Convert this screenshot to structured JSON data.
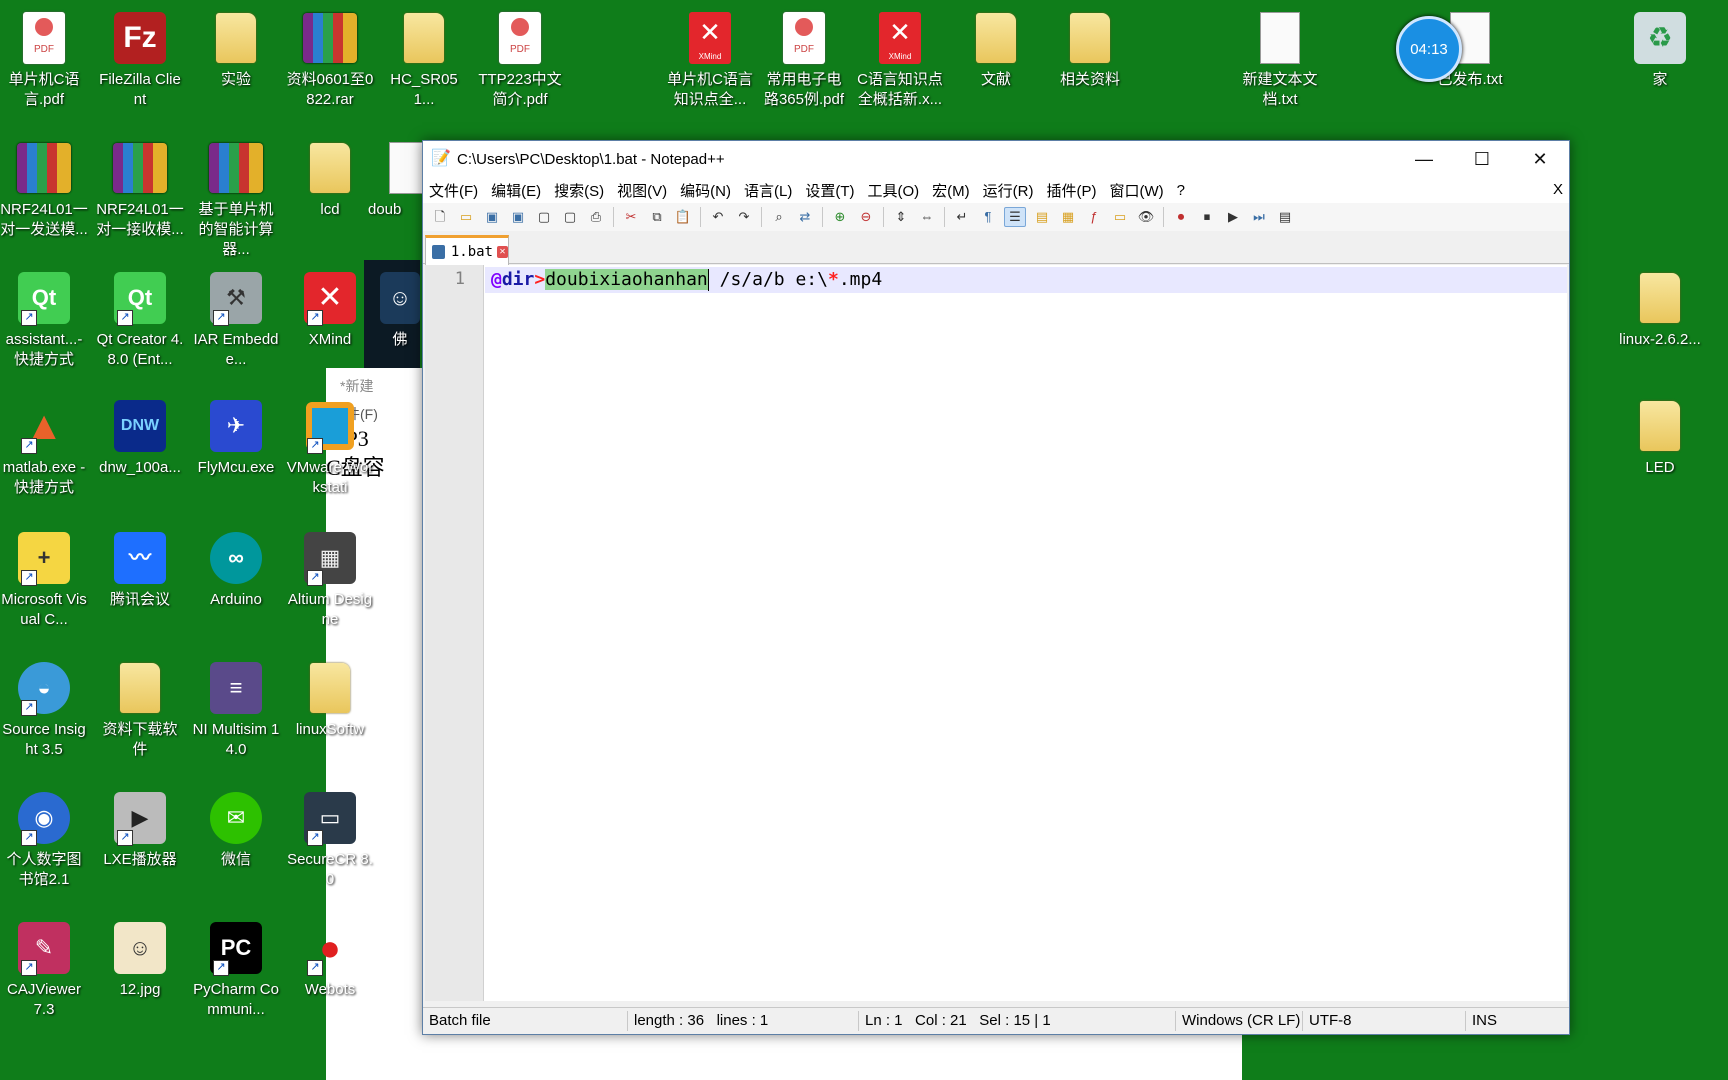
{
  "desktop": {
    "icons": [
      {
        "label": "单片机C语言.pdf",
        "icon": "pdf-icon"
      },
      {
        "label": "FileZilla Client",
        "icon": "filezilla-icon"
      },
      {
        "label": "实验",
        "icon": "folder-icon"
      },
      {
        "label": "资料0601至0822.rar",
        "icon": "rar-icon"
      },
      {
        "label": "HC_SR051...",
        "icon": "folder-icon"
      },
      {
        "label": "TTP223中文简介.pdf",
        "icon": "pdf-icon"
      },
      {
        "label": "单片机C语言知识点全...",
        "icon": "xmind-file-icon"
      },
      {
        "label": "常用电子电路365例.pdf",
        "icon": "pdf-icon"
      },
      {
        "label": "C语言知识点全概括新.x...",
        "icon": "xmind-file-icon"
      },
      {
        "label": "文献",
        "icon": "folder-icon"
      },
      {
        "label": "相关资料",
        "icon": "folder-icon"
      },
      {
        "label": "新建文本文档.txt",
        "icon": "txt-icon"
      },
      {
        "label": "已发布.txt",
        "icon": "txt-icon"
      },
      {
        "label": "家",
        "icon": "recycle-bin-icon"
      },
      {
        "label": "NRF24L01一对一发送模...",
        "icon": "rar-icon"
      },
      {
        "label": "NRF24L01一对一接收模...",
        "icon": "rar-icon"
      },
      {
        "label": "基于单片机的智能计算器...",
        "icon": "rar-icon"
      },
      {
        "label": "lcd",
        "icon": "folder-icon"
      },
      {
        "label": "doub",
        "icon": "file-icon"
      },
      {
        "label": "assistant...- 快捷方式",
        "icon": "qt-assistant-icon"
      },
      {
        "label": "Qt Creator 4.8.0 (Ent...",
        "icon": "qt-creator-icon"
      },
      {
        "label": "IAR Embedde...",
        "icon": "iar-icon"
      },
      {
        "label": "XMind",
        "icon": "xmind-icon"
      },
      {
        "label": "佛",
        "icon": "image-icon"
      },
      {
        "label": "linux-2.6.2...",
        "icon": "folder-icon"
      },
      {
        "label": "matlab.exe - 快捷方式",
        "icon": "matlab-icon"
      },
      {
        "label": "dnw_100a...",
        "icon": "dnw-icon"
      },
      {
        "label": "FlyMcu.exe",
        "icon": "flymcu-icon"
      },
      {
        "label": "VMware Workstati",
        "icon": "vmware-icon"
      },
      {
        "label": "LED",
        "icon": "folder-icon"
      },
      {
        "label": "Microsoft Visual C...",
        "icon": "visual-c-icon"
      },
      {
        "label": "腾讯会议",
        "icon": "tencent-meeting-icon"
      },
      {
        "label": "Arduino",
        "icon": "arduino-icon"
      },
      {
        "label": "Altium Designe",
        "icon": "altium-icon"
      },
      {
        "label": "Source Insight 3.5",
        "icon": "source-insight-icon"
      },
      {
        "label": "资料下载软件",
        "icon": "folder-icon"
      },
      {
        "label": "NI Multisim 14.0",
        "icon": "multisim-icon"
      },
      {
        "label": "linuxSoftw",
        "icon": "folder-icon"
      },
      {
        "label": "个人数字图书馆2.1",
        "icon": "library-icon"
      },
      {
        "label": "LXE播放器",
        "icon": "player-icon"
      },
      {
        "label": "微信",
        "icon": "wechat-icon"
      },
      {
        "label": "SecureCR 8.0",
        "icon": "securecrt-icon"
      },
      {
        "label": "CAJViewer 7.3",
        "icon": "cajviewer-icon"
      },
      {
        "label": "12.jpg",
        "icon": "image-icon"
      },
      {
        "label": "PyCharm Communi...",
        "icon": "pycharm-icon"
      },
      {
        "label": "Webots",
        "icon": "webots-icon"
      }
    ],
    "clock": "04:13",
    "bg_window": {
      "title": "*新建",
      "menu": "文件(F)",
      "line1": "MP3",
      "line2": "C盘容"
    }
  },
  "notepad": {
    "title": "C:\\Users\\PC\\Desktop\\1.bat - Notepad++",
    "menu": [
      "文件(F)",
      "编辑(E)",
      "搜索(S)",
      "视图(V)",
      "编码(N)",
      "语言(L)",
      "设置(T)",
      "工具(O)",
      "宏(M)",
      "运行(R)",
      "插件(P)",
      "窗口(W)",
      "?"
    ],
    "menu_close": "X",
    "tab": "1.bat",
    "line_number": "1",
    "code": {
      "at": "@",
      "cmd": "dir",
      "redirect": ">",
      "selected": "doubixiaohanhan",
      "args1": " /s/a/b e:\\",
      "star": "*",
      "args2": ".mp4"
    },
    "status": {
      "type": "Batch file",
      "length": "length : 36",
      "lines": "lines : 1",
      "ln": "Ln : 1",
      "col": "Col : 21",
      "sel": "Sel : 15 | 1",
      "eol": "Windows (CR LF)",
      "encoding": "UTF-8",
      "mode": "INS"
    }
  },
  "colors": {
    "desktop_bg": "#0f7d1a",
    "selection": "#8fd48f",
    "current_line": "#e8e8ff"
  }
}
